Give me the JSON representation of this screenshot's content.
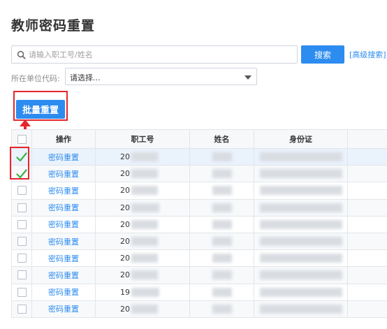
{
  "page": {
    "title": "教师密码重置"
  },
  "search": {
    "placeholder": "请输入职工号/姓名",
    "button_label": "搜索",
    "advanced_link": "[高级搜索]"
  },
  "filter": {
    "unit_label": "所在单位代码:",
    "unit_value": "请选择..."
  },
  "batch": {
    "reset_label": "批量重置"
  },
  "colors": {
    "accent": "#2d8cf0",
    "highlight": "#e5262c",
    "check": "#3bb34a"
  },
  "table": {
    "headers": [
      "",
      "操作",
      "职工号",
      "姓名",
      "身份证"
    ],
    "rows": [
      {
        "checked": true,
        "action": "密码重置",
        "id_prefix": "20"
      },
      {
        "checked": true,
        "action": "密码重置",
        "id_prefix": "20"
      },
      {
        "checked": false,
        "action": "密码重置",
        "id_prefix": "20"
      },
      {
        "checked": false,
        "action": "密码重置",
        "id_prefix": "20"
      },
      {
        "checked": false,
        "action": "密码重置",
        "id_prefix": "20"
      },
      {
        "checked": false,
        "action": "密码重置",
        "id_prefix": "20"
      },
      {
        "checked": false,
        "action": "密码重置",
        "id_prefix": "20"
      },
      {
        "checked": false,
        "action": "密码重置",
        "id_prefix": "20"
      },
      {
        "checked": false,
        "action": "密码重置",
        "id_prefix": "19"
      },
      {
        "checked": false,
        "action": "密码重置",
        "id_prefix": "20"
      }
    ]
  }
}
